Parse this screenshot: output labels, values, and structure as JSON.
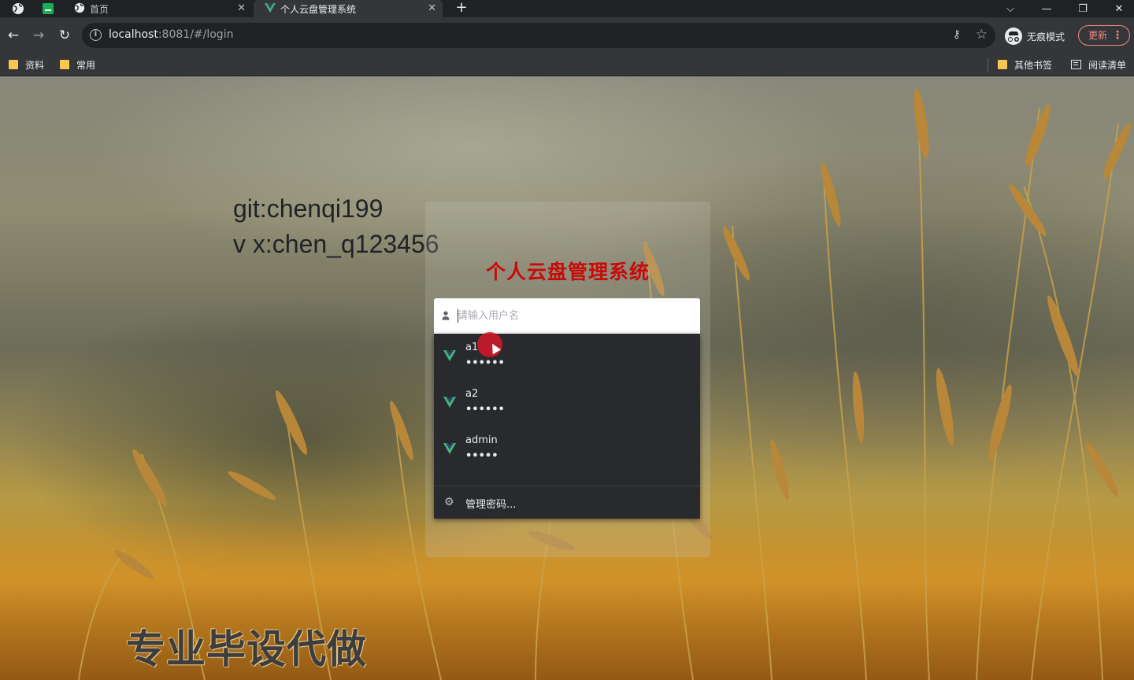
{
  "browser": {
    "tabs": [
      {
        "title": "首页",
        "active": false
      },
      {
        "title": "个人云盘管理系统",
        "active": true
      }
    ],
    "new_tab": "+",
    "close_glyph": "✕",
    "url_host": "localhost",
    "url_rest": ":8081/#/login",
    "profile_label": "无痕模式",
    "update_label": "更新",
    "update_menu": "⋮",
    "bookmarks": [
      "资料",
      "常用"
    ],
    "other_bookmarks": "其他书签",
    "reading_list": "阅读清单"
  },
  "page": {
    "overlay_line1": "git:chenqi199",
    "overlay_line2": "v x:chen_q123456",
    "watermark": "专业毕设代做",
    "login": {
      "title": "个人云盘管理系统",
      "username_placeholder": "请输入用户名"
    },
    "autocomplete": {
      "items": [
        {
          "user": "a1",
          "password": "••••••"
        },
        {
          "user": "a2",
          "password": "••••••"
        },
        {
          "user": "admin",
          "password": "•••••"
        }
      ],
      "manage_label": "管理密码..."
    }
  },
  "colors": {
    "title_red": "#c80a0a",
    "vue_green": "#41b883",
    "dropdown_bg": "#292a2d",
    "update_accent": "#f28b82"
  }
}
